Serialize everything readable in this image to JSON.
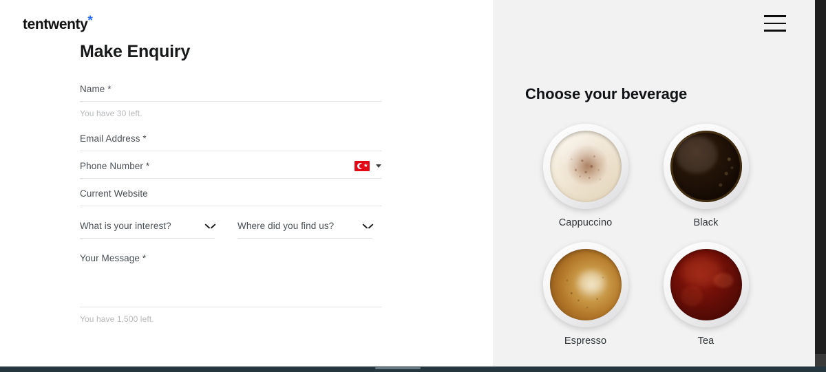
{
  "brand": {
    "logo_text": "tentwenty",
    "logo_mark": "*",
    "accent_color": "#2b6ef5"
  },
  "form": {
    "title": "Make Enquiry",
    "fields": [
      {
        "label": "Name *",
        "value": "",
        "counter": "You have 30 left."
      },
      {
        "label": "Email Address *",
        "value": ""
      },
      {
        "label": "Phone Number *",
        "value": "",
        "country_flag": "turkey-flag-icon"
      },
      {
        "label": "Current Website",
        "value": ""
      }
    ],
    "selects": [
      {
        "label": "What is your interest?",
        "value": "",
        "icon": "chevron-down-icon"
      },
      {
        "label": "Where did you find us?",
        "value": "",
        "icon": "chevron-down-icon"
      }
    ],
    "message": {
      "label": "Your Message *",
      "value": "",
      "counter": "You have 1,500 left."
    }
  },
  "beverage": {
    "heading": "Choose your beverage",
    "menu_icon": "hamburger-menu-icon",
    "options": [
      {
        "label": "Cappuccino",
        "swatch": "#e4d6bd"
      },
      {
        "label": "Black",
        "swatch": "#1a0e06"
      },
      {
        "label": "Espresso",
        "swatch": "#c79644"
      },
      {
        "label": "Tea",
        "swatch": "#7a1209"
      }
    ]
  },
  "chrome": {
    "panel_background": "#f2f2f2",
    "page_background": "#ffffff",
    "bottom_bar_color": "#26363f"
  }
}
